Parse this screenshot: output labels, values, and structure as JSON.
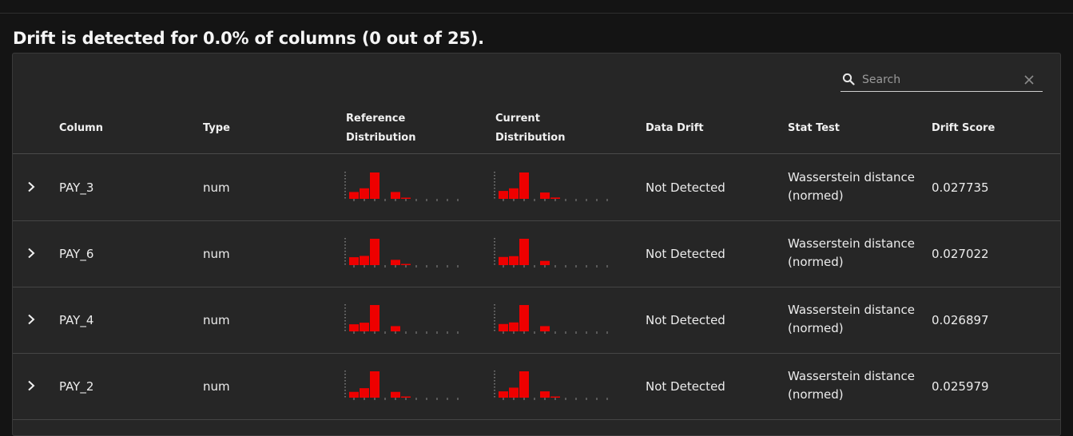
{
  "headline": "Drift is detected for 0.0% of columns (0 out of 25).",
  "search": {
    "placeholder": "Search",
    "value": ""
  },
  "headers": {
    "column": "Column",
    "type": "Type",
    "reference_line1": "Reference",
    "reference_line2": "Distribution",
    "current_line1": "Current",
    "current_line2": "Distribution",
    "data_drift": "Data Drift",
    "stat_test": "Stat Test",
    "drift_score": "Drift Score"
  },
  "colors": {
    "bar": "#ee0000",
    "axis": "#6a6a6a",
    "background": "#262626",
    "page": "#141414"
  },
  "icons": {
    "search": "search-icon",
    "clear": "close-icon",
    "expand": "chevron-right-icon"
  },
  "rows": [
    {
      "column": "PAY_3",
      "type": "num",
      "data_drift": "Not Detected",
      "stat_test_line1": "Wasserstein distance",
      "stat_test_line2": "(normed)",
      "drift_score": "0.027735",
      "reference_hist": [
        0.26,
        0.4,
        1.0,
        0,
        0.26,
        0.04,
        0,
        0,
        0,
        0,
        0
      ],
      "current_hist": [
        0.3,
        0.4,
        1.0,
        0,
        0.24,
        0.05,
        0,
        0,
        0,
        0,
        0
      ]
    },
    {
      "column": "PAY_6",
      "type": "num",
      "data_drift": "Not Detected",
      "stat_test_line1": "Wasserstein distance",
      "stat_test_line2": "(normed)",
      "drift_score": "0.027022",
      "reference_hist": [
        0.3,
        0.35,
        1.0,
        0,
        0.2,
        0.03,
        0,
        0,
        0,
        0,
        0
      ],
      "current_hist": [
        0.31,
        0.34,
        1.0,
        0,
        0.16,
        0,
        0,
        0,
        0,
        0,
        0
      ]
    },
    {
      "column": "PAY_4",
      "type": "num",
      "data_drift": "Not Detected",
      "stat_test_line1": "Wasserstein distance",
      "stat_test_line2": "(normed)",
      "drift_score": "0.026897",
      "reference_hist": [
        0.27,
        0.33,
        1.0,
        0,
        0.2,
        0,
        0,
        0,
        0,
        0,
        0
      ],
      "current_hist": [
        0.28,
        0.34,
        1.0,
        0,
        0.2,
        0,
        0,
        0,
        0,
        0,
        0
      ]
    },
    {
      "column": "PAY_2",
      "type": "num",
      "data_drift": "Not Detected",
      "stat_test_line1": "Wasserstein distance",
      "stat_test_line2": "(normed)",
      "drift_score": "0.025979",
      "reference_hist": [
        0.22,
        0.36,
        1.0,
        0,
        0.22,
        0.03,
        0,
        0,
        0,
        0,
        0
      ],
      "current_hist": [
        0.24,
        0.38,
        1.0,
        0,
        0.24,
        0.03,
        0,
        0,
        0,
        0,
        0
      ]
    }
  ]
}
